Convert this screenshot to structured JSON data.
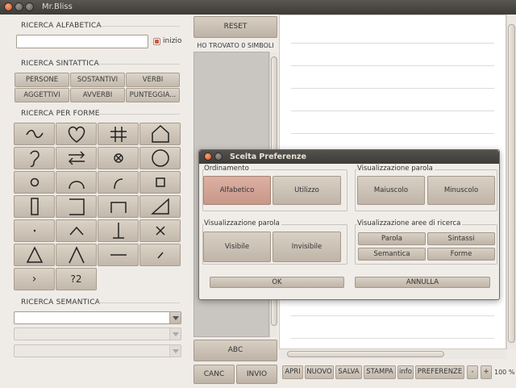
{
  "window": {
    "title": "Mr.Bliss"
  },
  "left": {
    "alpha_title": "RICERCA ALFABETICA",
    "search_value": "",
    "inizio_label": "inizio",
    "syntax_title": "RICERCA SINTATTICA",
    "syntax_buttons": [
      "PERSONE",
      "SOSTANTIVI",
      "VERBI",
      "AGGETTIVI",
      "AVVERBI",
      "PUNTEGGIA..."
    ],
    "shapes_title": "RICERCA PER FORME",
    "shape_icons": [
      "tilde-icon",
      "heart-icon",
      "hash-icon",
      "house-icon",
      "ear-hook-icon",
      "exchange-arrows-icon",
      "circled-cross-icon",
      "large-circle-icon",
      "small-circle-icon",
      "arc-icon",
      "small-arc-icon",
      "small-square-icon",
      "tall-rectangle-icon",
      "open-bracket-icon",
      "gate-icon",
      "right-triangle-icon",
      "dot-icon",
      "caret-icon",
      "inverted-t-icon",
      "x-cross-icon",
      "triangle-icon",
      "lambda-icon",
      "horizontal-line-icon",
      "slash-icon",
      "greater-than-icon",
      "question-two-icon"
    ],
    "shape_text": {
      "gt": "›",
      "q2": "?2"
    },
    "semantic_title": "RICERCA SEMANTICA"
  },
  "middle": {
    "reset_label": "RESET",
    "found_text": "HO TROVATO 0 SIMBOLI",
    "abc_label": "ABC",
    "canc_label": "CANC",
    "invio_label": "INVIO"
  },
  "bottom_bar": {
    "buttons": [
      "APRI",
      "NUOVO",
      "SALVA",
      "STAMPA",
      "info",
      "PREFERENZE",
      "-",
      "+"
    ],
    "zoom": "100 %"
  },
  "dialog": {
    "title": "Scelta Preferenze",
    "ordinamento": {
      "label": "Ordinamento",
      "options": [
        "Alfabetico",
        "Utilizzo"
      ],
      "selected": "Alfabetico"
    },
    "case": {
      "label": "Visualizzazione parola",
      "options": [
        "Maiuscolo",
        "Minuscolo"
      ]
    },
    "visibility": {
      "label": "Visualizzazione parola",
      "options": [
        "Visibile",
        "Invisibile"
      ]
    },
    "areas": {
      "label": "Visualizzazione aree di ricerca",
      "options": [
        "Parola",
        "Sintassi",
        "Semantica",
        "Forme"
      ]
    },
    "ok_label": "OK",
    "cancel_label": "ANNULLA"
  },
  "colors": {
    "accent": "#d4563a",
    "titlebar": "#3c3b37",
    "button": "#c9bfb3",
    "selected": "#d3a597"
  }
}
